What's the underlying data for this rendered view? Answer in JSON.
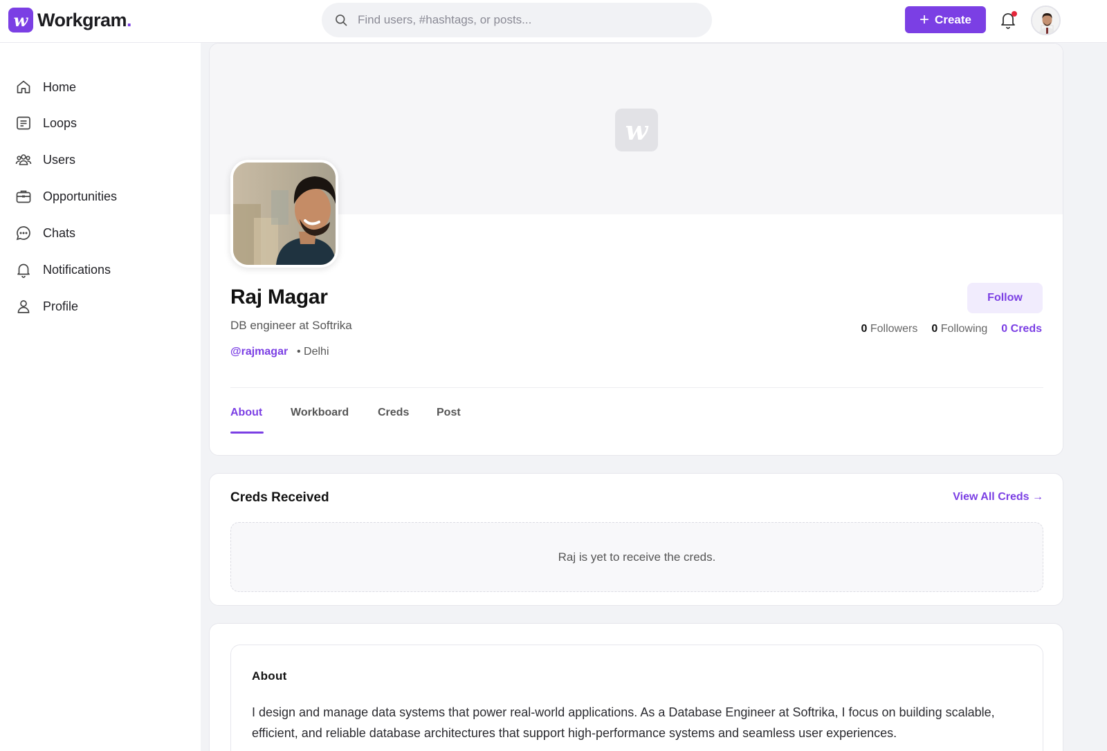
{
  "app": {
    "name": "Workgram",
    "logo_letter": "w",
    "brand_color": "#7b3fe4"
  },
  "topbar": {
    "search_placeholder": "Find users, #hashtags, or posts...",
    "create_label": "Create",
    "icons": [
      "search-icon",
      "plus-icon",
      "bell-icon",
      "avatar"
    ]
  },
  "sidebar": {
    "items": [
      {
        "label": "Home",
        "icon": "home-icon"
      },
      {
        "label": "Loops",
        "icon": "loops-icon"
      },
      {
        "label": "Users",
        "icon": "users-icon"
      },
      {
        "label": "Opportunities",
        "icon": "briefcase-icon"
      },
      {
        "label": "Chats",
        "icon": "chat-icon"
      },
      {
        "label": "Notifications",
        "icon": "bell-icon"
      },
      {
        "label": "Profile",
        "icon": "user-icon"
      }
    ]
  },
  "profile": {
    "name": "Raj Magar",
    "headline": "DB engineer at Softrika",
    "handle": "@rajmagar",
    "location": "• Delhi",
    "follow_label": "Follow",
    "stats": {
      "followers_count": "0",
      "followers_label": "Followers",
      "following_count": "0",
      "following_label": "Following",
      "creds_label": "0 Creds"
    },
    "tabs": [
      {
        "label": "About",
        "active": true
      },
      {
        "label": "Workboard",
        "active": false
      },
      {
        "label": "Creds",
        "active": false
      },
      {
        "label": "Post",
        "active": false
      }
    ]
  },
  "creds_received": {
    "title": "Creds Received",
    "view_all_label": "View All Creds →",
    "empty_message": "Raj is yet to receive the creds."
  },
  "about": {
    "title": "About",
    "text": "I design and manage data systems that power real-world applications. As a Database Engineer at Softrika, I focus on building scalable, efficient, and reliable database architectures that support high-performance systems and seamless user experiences."
  }
}
